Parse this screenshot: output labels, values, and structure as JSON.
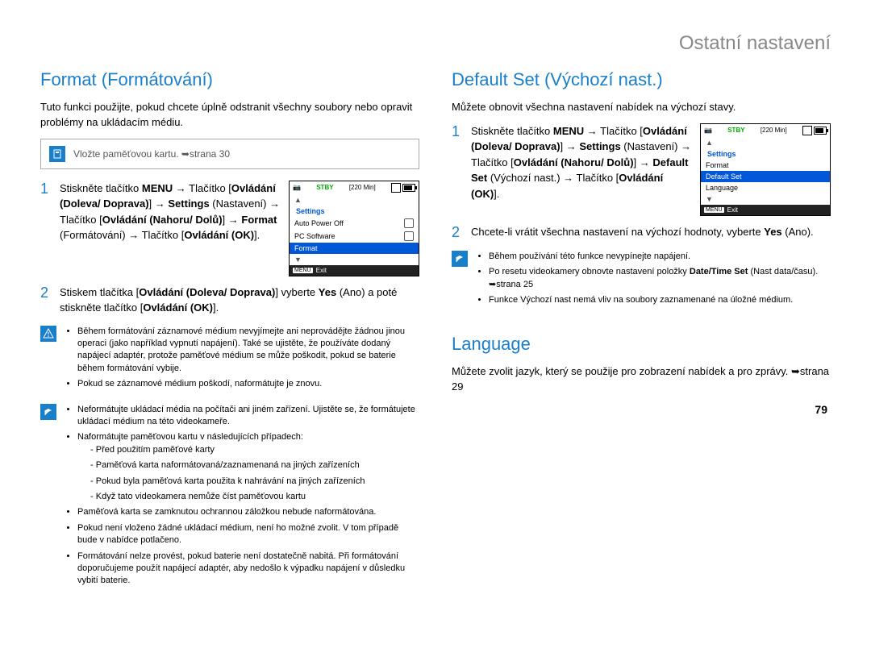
{
  "page_title": "Ostatní nastavení",
  "page_number": "79",
  "left": {
    "heading": "Format (Formátování)",
    "intro": "Tuto funkci použijte, pokud chcete úplně odstranit všechny soubory nebo opravit problémy na ukládacím médiu.",
    "insert_card": "Vložte paměťovou kartu. ➥strana 30",
    "step1_a": "Stiskněte tlačítko ",
    "step1_menu": "MENU",
    "step1_b": " → Tlačítko ",
    "step1_ctrl1": "Ovládání (Doleva/ Doprava)",
    "step1_c": "] → ",
    "step1_settings": "Settings",
    "step1_d": " (Nastavení) → Tlačítko [",
    "step1_ctrl2": "Ovládání (Nahoru/ Dolů)",
    "step1_e": "] → ",
    "step1_format": "Format",
    "step1_f": " (Formátování) → Tlačítko [",
    "step1_ok": "Ovládání (OK)",
    "step1_g": "].",
    "step2_a": "Stiskem tlačítka [",
    "step2_ctrl": "Ovládání (Doleva/ Doprava)",
    "step2_b": "] vyberte ",
    "step2_yes": "Yes",
    "step2_c": " (Ano) a poté stiskněte tlačítko [",
    "step2_ok": "Ovládání (OK)",
    "step2_d": "].",
    "warn1": "Během formátování záznamové médium nevyjímejte ani neprovádějte žádnou jinou operaci (jako například vypnutí napájení). Také se ujistěte, že používáte dodaný napájecí adaptér, protože paměťové médium se může poškodit, pokud se baterie během formátování vybije.",
    "warn2": "Pokud se záznamové médium poškodí, naformátujte je znovu.",
    "note1": "Neformátujte ukládací média na počítači ani jiném zařízení. Ujistěte se, že formátujete ukládací médium na této videokameře.",
    "note2": "Naformátujte paměťovou kartu v následujících případech:",
    "note2a": "Před použitím paměťové karty",
    "note2b": "Paměťová karta naformátovaná/zaznamenaná na jiných zařízeních",
    "note2c": "Pokud byla paměťová karta použita k nahrávání na jiných zařízeních",
    "note2d": "Když tato videokamera nemůže číst paměťovou kartu",
    "note3": "Paměťová karta se zamknutou ochrannou záložkou nebude naformátována.",
    "note4": "Pokud není vloženo žádné ukládací médium, není ho možné zvolit. V tom případě bude v nabídce potlačeno.",
    "note5": "Formátování nelze provést, pokud baterie není dostatečně nabitá. Při formátování doporučujeme použít napájecí adaptér, aby nedošlo k výpadku napájení v důsledku vybití baterie.",
    "lcd": {
      "stby": "STBY",
      "time": "[220 Min]",
      "title": "Settings",
      "row1": "Auto Power Off",
      "row2": "PC Software",
      "row3": "Format",
      "exit": "Exit"
    }
  },
  "right": {
    "heading1": "Default Set (Výchozí nast.)",
    "intro1": "Můžete obnovit všechna nastavení nabídek na výchozí stavy.",
    "step1_a": "Stiskněte tlačítko ",
    "step1_menu": "MENU",
    "step1_b": " → Tlačítko [",
    "step1_ctrl1": "Ovládání (Doleva/ Doprava)",
    "step1_c": "] → ",
    "step1_settings": "Settings",
    "step1_d": " (Nastavení) → Tlačítko [",
    "step1_ctrl2": "Ovládání (Nahoru/ Dolů)",
    "step1_e": "] → ",
    "step1_default": "Default Set",
    "step1_f": " (Výchozí nast.) → Tlačítko [",
    "step1_ok": "Ovládání (OK)",
    "step1_g": "].",
    "step2_a": "Chcete-li vrátit všechna nastavení na výchozí hodnoty, vyberte ",
    "step2_yes": "Yes",
    "step2_b": " (Ano).",
    "note_r1": "Během používání této funkce nevypínejte napájení.",
    "note_r2_a": "Po resetu videokamery obnovte nastavení položky ",
    "note_r2_b": "Date/Time Set",
    "note_r2_c": " (Nast data/času). ➥strana 25",
    "note_r3": "Funkce Výchozí nast nemá vliv na soubory zaznamenané na úložné médium.",
    "heading2": "Language",
    "intro2": "Můžete zvolit jazyk, který se použije pro zobrazení nabídek a pro zprávy. ➥strana 29",
    "lcd": {
      "stby": "STBY",
      "time": "[220 Min]",
      "title": "Settings",
      "row1": "Format",
      "row2": "Default Set",
      "row3": "Language",
      "exit": "Exit"
    }
  }
}
